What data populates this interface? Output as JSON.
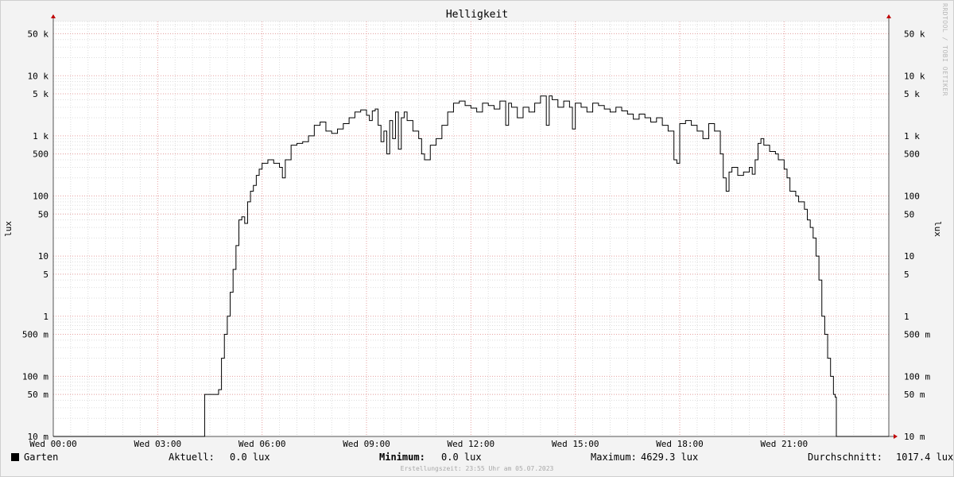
{
  "chart_data": {
    "type": "line",
    "title": "Helligkeit",
    "ylabel": "lux",
    "yscale": "log",
    "ylim": [
      0.01,
      80000
    ],
    "grid": true,
    "x_ticks": [
      "Wed 00:00",
      "Wed 03:00",
      "Wed 06:00",
      "Wed 09:00",
      "Wed 12:00",
      "Wed 15:00",
      "Wed 18:00",
      "Wed 21:00"
    ],
    "y_ticks": [
      {
        "value": 50000,
        "label": "50 k"
      },
      {
        "value": 10000,
        "label": "10 k"
      },
      {
        "value": 5000,
        "label": "5 k"
      },
      {
        "value": 1000,
        "label": "1 k"
      },
      {
        "value": 500,
        "label": "500"
      },
      {
        "value": 100,
        "label": "100"
      },
      {
        "value": 50,
        "label": "50"
      },
      {
        "value": 10,
        "label": "10"
      },
      {
        "value": 5,
        "label": "5"
      },
      {
        "value": 1,
        "label": "1"
      },
      {
        "value": 0.5,
        "label": "500 m"
      },
      {
        "value": 0.1,
        "label": "100 m"
      },
      {
        "value": 0.05,
        "label": "50 m"
      },
      {
        "value": 0.01,
        "label": "10 m"
      }
    ],
    "series": [
      {
        "name": "Garten",
        "color": "#000000",
        "points": [
          [
            "04:20",
            0.01
          ],
          [
            "04:21",
            0.05
          ],
          [
            "04:45",
            0.06
          ],
          [
            "04:50",
            0.2
          ],
          [
            "04:55",
            0.5
          ],
          [
            "05:00",
            1
          ],
          [
            "05:05",
            2.5
          ],
          [
            "05:10",
            6
          ],
          [
            "05:15",
            15
          ],
          [
            "05:20",
            40
          ],
          [
            "05:25",
            45
          ],
          [
            "05:30",
            35
          ],
          [
            "05:35",
            80
          ],
          [
            "05:40",
            120
          ],
          [
            "05:45",
            150
          ],
          [
            "05:50",
            220
          ],
          [
            "05:55",
            280
          ],
          [
            "06:00",
            350
          ],
          [
            "06:10",
            400
          ],
          [
            "06:20",
            350
          ],
          [
            "06:30",
            300
          ],
          [
            "06:35",
            200
          ],
          [
            "06:40",
            400
          ],
          [
            "06:50",
            700
          ],
          [
            "07:00",
            750
          ],
          [
            "07:10",
            800
          ],
          [
            "07:20",
            1000
          ],
          [
            "07:30",
            1500
          ],
          [
            "07:40",
            1700
          ],
          [
            "07:50",
            1200
          ],
          [
            "08:00",
            1100
          ],
          [
            "08:10",
            1300
          ],
          [
            "08:20",
            1600
          ],
          [
            "08:30",
            2000
          ],
          [
            "08:40",
            2500
          ],
          [
            "08:50",
            2700
          ],
          [
            "09:00",
            2200
          ],
          [
            "09:05",
            1800
          ],
          [
            "09:10",
            2600
          ],
          [
            "09:15",
            2800
          ],
          [
            "09:20",
            1500
          ],
          [
            "09:25",
            800
          ],
          [
            "09:30",
            1200
          ],
          [
            "09:35",
            500
          ],
          [
            "09:40",
            1800
          ],
          [
            "09:45",
            900
          ],
          [
            "09:50",
            2500
          ],
          [
            "09:55",
            600
          ],
          [
            "10:00",
            2000
          ],
          [
            "10:05",
            2500
          ],
          [
            "10:10",
            1800
          ],
          [
            "10:20",
            1200
          ],
          [
            "10:30",
            900
          ],
          [
            "10:35",
            500
          ],
          [
            "10:40",
            400
          ],
          [
            "10:50",
            700
          ],
          [
            "11:00",
            900
          ],
          [
            "11:10",
            1500
          ],
          [
            "11:20",
            2500
          ],
          [
            "11:30",
            3500
          ],
          [
            "11:40",
            3800
          ],
          [
            "11:50",
            3200
          ],
          [
            "12:00",
            2900
          ],
          [
            "12:10",
            2500
          ],
          [
            "12:20",
            3500
          ],
          [
            "12:30",
            3200
          ],
          [
            "12:40",
            2800
          ],
          [
            "12:50",
            3800
          ],
          [
            "13:00",
            1500
          ],
          [
            "13:05",
            3500
          ],
          [
            "13:10",
            3000
          ],
          [
            "13:20",
            2000
          ],
          [
            "13:30",
            3000
          ],
          [
            "13:40",
            2500
          ],
          [
            "13:50",
            3500
          ],
          [
            "14:00",
            4600
          ],
          [
            "14:10",
            1500
          ],
          [
            "14:15",
            4629
          ],
          [
            "14:20",
            4000
          ],
          [
            "14:30",
            3000
          ],
          [
            "14:40",
            3800
          ],
          [
            "14:50",
            3000
          ],
          [
            "14:55",
            1300
          ],
          [
            "15:00",
            3500
          ],
          [
            "15:10",
            3000
          ],
          [
            "15:20",
            2500
          ],
          [
            "15:30",
            3500
          ],
          [
            "15:40",
            3200
          ],
          [
            "15:50",
            2800
          ],
          [
            "16:00",
            2500
          ],
          [
            "16:10",
            3000
          ],
          [
            "16:20",
            2600
          ],
          [
            "16:30",
            2300
          ],
          [
            "16:40",
            1900
          ],
          [
            "16:50",
            2300
          ],
          [
            "17:00",
            2000
          ],
          [
            "17:10",
            1700
          ],
          [
            "17:20",
            2000
          ],
          [
            "17:30",
            1500
          ],
          [
            "17:40",
            1200
          ],
          [
            "17:50",
            400
          ],
          [
            "17:55",
            350
          ],
          [
            "18:00",
            1600
          ],
          [
            "18:10",
            1800
          ],
          [
            "18:20",
            1500
          ],
          [
            "18:30",
            1200
          ],
          [
            "18:40",
            900
          ],
          [
            "18:50",
            1600
          ],
          [
            "19:00",
            1200
          ],
          [
            "19:10",
            500
          ],
          [
            "19:15",
            200
          ],
          [
            "19:20",
            120
          ],
          [
            "19:25",
            250
          ],
          [
            "19:30",
            300
          ],
          [
            "19:40",
            220
          ],
          [
            "19:50",
            250
          ],
          [
            "20:00",
            300
          ],
          [
            "20:05",
            230
          ],
          [
            "20:10",
            400
          ],
          [
            "20:15",
            750
          ],
          [
            "20:20",
            900
          ],
          [
            "20:25",
            700
          ],
          [
            "20:35",
            550
          ],
          [
            "20:45",
            500
          ],
          [
            "20:50",
            400
          ],
          [
            "21:00",
            280
          ],
          [
            "21:05",
            200
          ],
          [
            "21:10",
            120
          ],
          [
            "21:20",
            100
          ],
          [
            "21:25",
            80
          ],
          [
            "21:35",
            60
          ],
          [
            "21:40",
            40
          ],
          [
            "21:45",
            30
          ],
          [
            "21:50",
            20
          ],
          [
            "21:55",
            10
          ],
          [
            "22:00",
            4
          ],
          [
            "22:05",
            1
          ],
          [
            "22:10",
            0.5
          ],
          [
            "22:15",
            0.2
          ],
          [
            "22:20",
            0.1
          ],
          [
            "22:25",
            0.05
          ],
          [
            "22:28",
            0.045
          ],
          [
            "22:30",
            0.01
          ],
          [
            "23:55",
            0.01
          ]
        ]
      }
    ]
  },
  "legend": {
    "series_name": "Garten",
    "current_label": "Aktuell:",
    "current_value": "0.0 lux",
    "min_label": "Minimum:",
    "min_value": "0.0 lux",
    "max_label": "Maximum:",
    "max_value": "4629.3 lux",
    "avg_label": "Durchschnitt:",
    "avg_value": "1017.4 lux"
  },
  "footer": "Erstellungszeit: 23:55 Uhr am 05.07.2023",
  "watermark": "RRDTOOL / TOBI OETIKER",
  "colors": {
    "minor_grid": "#dddddd",
    "major_grid": "#e6a0a0",
    "axis": "#555555",
    "arrow": "#c00000"
  }
}
